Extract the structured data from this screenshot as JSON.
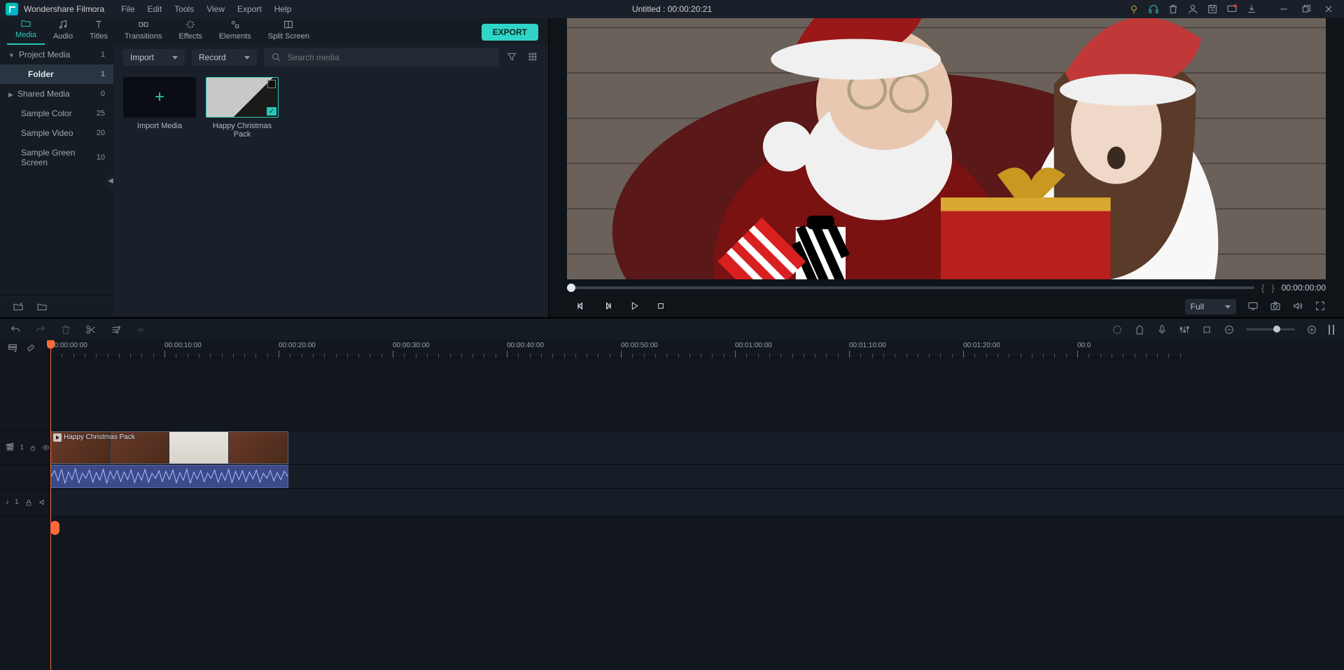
{
  "app_title": "Wondershare Filmora",
  "menus": [
    "File",
    "Edit",
    "Tools",
    "View",
    "Export",
    "Help"
  ],
  "project_title": "Untitled : 00:00:20:21",
  "tabs": [
    {
      "label": "Media",
      "active": true
    },
    {
      "label": "Audio"
    },
    {
      "label": "Titles"
    },
    {
      "label": "Transitions"
    },
    {
      "label": "Effects"
    },
    {
      "label": "Elements"
    },
    {
      "label": "Split Screen"
    }
  ],
  "export_label": "EXPORT",
  "sidebar": {
    "items": [
      {
        "label": "Project Media",
        "count": "1",
        "header": true,
        "expandable": true
      },
      {
        "label": "Folder",
        "count": "1",
        "active": true
      },
      {
        "label": "Shared Media",
        "count": "0",
        "header": true,
        "expandable": true
      },
      {
        "label": "Sample Color",
        "count": "25",
        "sub": true
      },
      {
        "label": "Sample Video",
        "count": "20",
        "sub": true
      },
      {
        "label": "Sample Green Screen",
        "count": "10",
        "sub": true
      }
    ]
  },
  "content_toolbar": {
    "import_label": "Import",
    "record_label": "Record",
    "search_placeholder": "Search media"
  },
  "media_items": [
    {
      "label": "Import Media",
      "type": "import"
    },
    {
      "label": "Happy Christmas Pack",
      "type": "selected"
    }
  ],
  "preview": {
    "scrub_braces_l": "{",
    "scrub_braces_r": "}",
    "timecode": "00:00:00:00",
    "quality_label": "Full"
  },
  "timeline": {
    "ruler_marks": [
      "00:00:00:00",
      "00:00:10:00",
      "00:00:20:00",
      "00:00:30:00",
      "00:00:40:00",
      "00:00:50:00",
      "00:01:00:00",
      "00:01:10:00",
      "00:01:20:00",
      "00:0"
    ],
    "video_track_label": "1",
    "audio_track_label": "1",
    "clip_label": "Happy Christmas Pack"
  }
}
